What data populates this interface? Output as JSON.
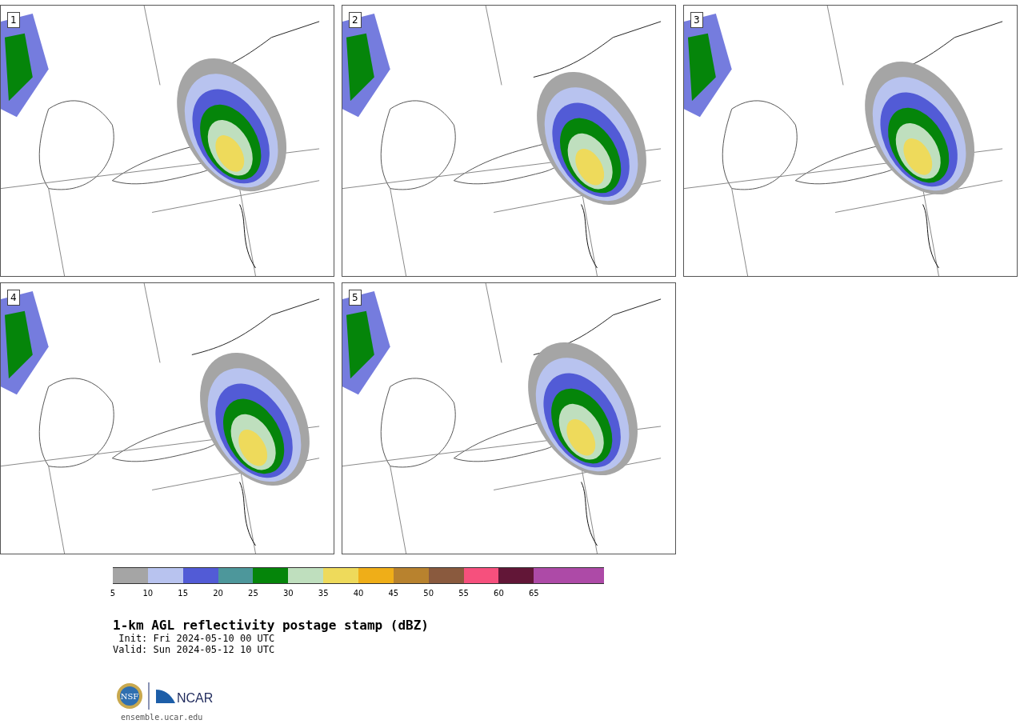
{
  "panels": [
    {
      "number": "1"
    },
    {
      "number": "2"
    },
    {
      "number": "3"
    },
    {
      "number": "4"
    },
    {
      "number": "5"
    }
  ],
  "colorbar": {
    "bins": [
      {
        "color": "#a5a5a5",
        "label": "5"
      },
      {
        "color": "#b8c3ef",
        "label": "10"
      },
      {
        "color": "#525bd6",
        "label": "15"
      },
      {
        "color": "#4d979b",
        "label": "20"
      },
      {
        "color": "#05850a",
        "label": "25"
      },
      {
        "color": "#bfdfbe",
        "label": "30"
      },
      {
        "color": "#eeda5b",
        "label": "35"
      },
      {
        "color": "#efae18",
        "label": "40"
      },
      {
        "color": "#b8822e",
        "label": "45"
      },
      {
        "color": "#8a5a3e",
        "label": "50"
      },
      {
        "color": "#f6507d",
        "label": "55"
      },
      {
        "color": "#621637",
        "label": "60"
      },
      {
        "color": "#ad4aa7",
        "label": "65"
      },
      {
        "color": "#ad4aa7"
      }
    ]
  },
  "title": "1-km AGL reflectivity postage stamp (dBZ)",
  "init": " Init: Fri 2024-05-10 00 UTC",
  "valid": "Valid: Sun 2024-05-12 10 UTC",
  "logo": {
    "seal": "NSF",
    "wordmark": "NCAR"
  },
  "site": "ensemble.ucar.edu"
}
